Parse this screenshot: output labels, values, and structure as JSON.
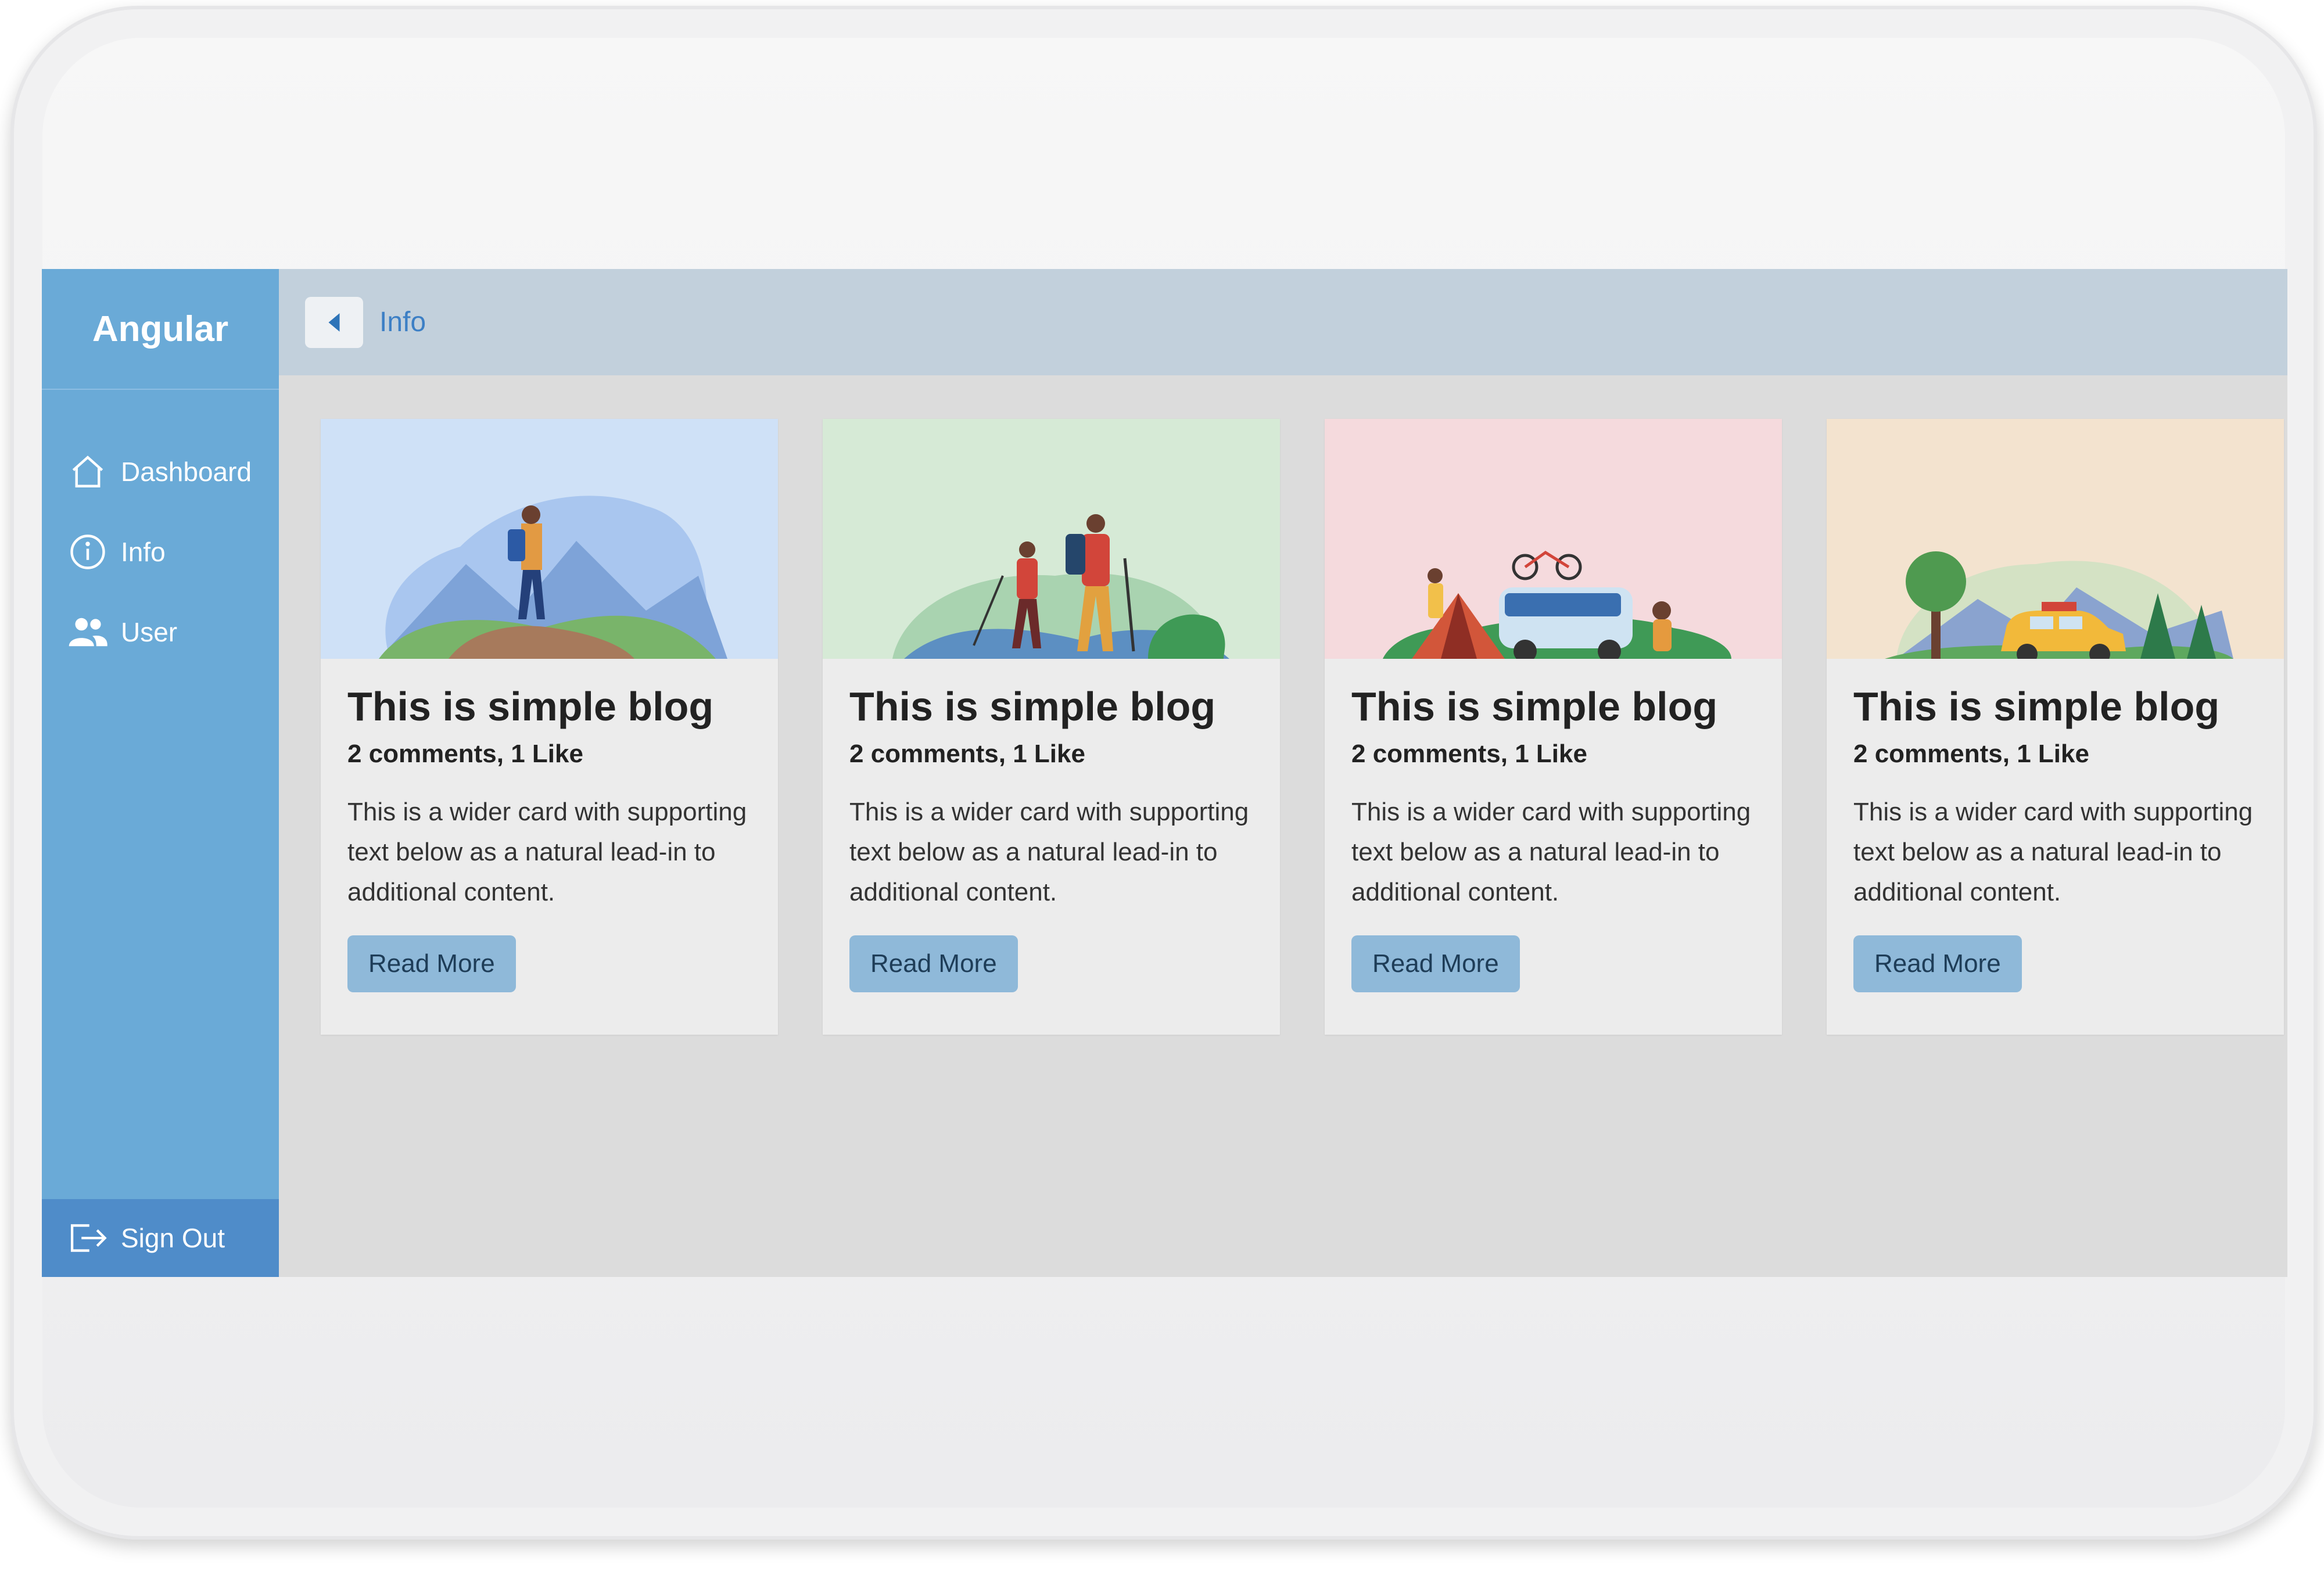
{
  "app": {
    "brand": "Angular"
  },
  "sidebar": {
    "items": [
      {
        "label": "Dashboard",
        "icon": "home-icon"
      },
      {
        "label": "Info",
        "icon": "info-icon"
      },
      {
        "label": "User",
        "icon": "users-icon"
      }
    ],
    "signout_label": "Sign Out"
  },
  "header": {
    "breadcrumb": "Info"
  },
  "cards": [
    {
      "title": "This is simple blog",
      "meta": "2 comments, 1 Like",
      "text": "This is a wider card with supporting text below as a natural lead-in to additional content.",
      "button": "Read More",
      "image_bg": "#cfe1f7",
      "image": "hiker-mountains-illustration"
    },
    {
      "title": "This is simple blog",
      "meta": "2 comments, 1 Like",
      "text": "This is a wider card with supporting text below as a natural lead-in to additional content.",
      "button": "Read More",
      "image_bg": "#d6ead6",
      "image": "trekking-couple-illustration"
    },
    {
      "title": "This is simple blog",
      "meta": "2 comments, 1 Like",
      "text": "This is a wider card with supporting text below as a natural lead-in to additional content.",
      "button": "Read More",
      "image_bg": "#f5dadd",
      "image": "camping-party-illustration"
    },
    {
      "title": "This is simple blog",
      "meta": "2 comments, 1 Like",
      "text": "This is a wider card with supporting text below as a natural lead-in to additional content.",
      "button": "Read More",
      "image_bg": "#f3e3cf",
      "image": "road-trip-car-illustration"
    }
  ],
  "colors": {
    "sidebar": "#6aaad7",
    "signout": "#4f8cc9",
    "topbar": "#c2d0dc",
    "button": "#8fb9d9",
    "link": "#3c7fc5"
  }
}
